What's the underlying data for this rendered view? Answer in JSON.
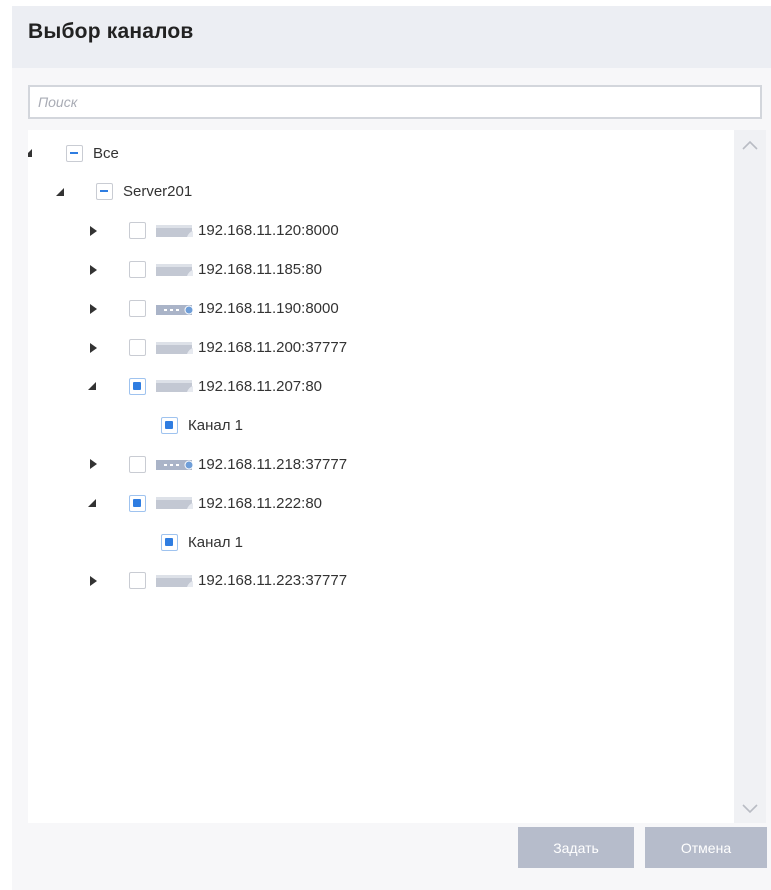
{
  "dialog": {
    "title": "Выбор каналов",
    "search": {
      "placeholder": "Поиск",
      "value": ""
    },
    "tree": {
      "root": {
        "label": "Все",
        "state": "partial",
        "expanded": true
      },
      "server": {
        "label": "Server201",
        "state": "partial",
        "expanded": true
      },
      "devices": [
        {
          "label": "192.168.11.120:8000",
          "icon": "camera-icon",
          "state": "unchecked",
          "expanded": false
        },
        {
          "label": "192.168.11.185:80",
          "icon": "camera-icon",
          "state": "unchecked",
          "expanded": false
        },
        {
          "label": "192.168.11.190:8000",
          "icon": "nvr-icon",
          "state": "unchecked",
          "expanded": false
        },
        {
          "label": "192.168.11.200:37777",
          "icon": "camera-icon",
          "state": "unchecked",
          "expanded": false
        },
        {
          "label": "192.168.11.207:80",
          "icon": "camera-icon",
          "state": "checked",
          "expanded": true,
          "channel": "Канал 1"
        },
        {
          "label": "192.168.11.218:37777",
          "icon": "nvr-icon",
          "state": "unchecked",
          "expanded": false
        },
        {
          "label": "192.168.11.222:80",
          "icon": "camera-icon",
          "state": "checked",
          "expanded": true,
          "channel": "Канал 1"
        },
        {
          "label": "192.168.11.223:37777",
          "icon": "camera-icon",
          "state": "unchecked",
          "expanded": false
        }
      ]
    },
    "buttons": {
      "set": "Задать",
      "cancel": "Отмена"
    },
    "colors": {
      "accent": "#2f7de1",
      "button": "#b6bccb",
      "header": "#eceef3"
    }
  }
}
